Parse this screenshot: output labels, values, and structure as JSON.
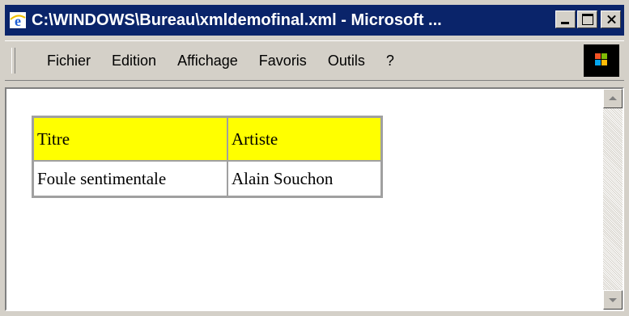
{
  "window": {
    "title": "C:\\WINDOWS\\Bureau\\xmldemofinal.xml - Microsoft ..."
  },
  "menu": {
    "items": [
      "Fichier",
      "Edition",
      "Affichage",
      "Favoris",
      "Outils",
      "?"
    ]
  },
  "table": {
    "header_bg": "#ffff00",
    "headers": [
      "Titre",
      "Artiste"
    ],
    "rows": [
      [
        "Foule sentimentale",
        "Alain Souchon"
      ]
    ]
  }
}
